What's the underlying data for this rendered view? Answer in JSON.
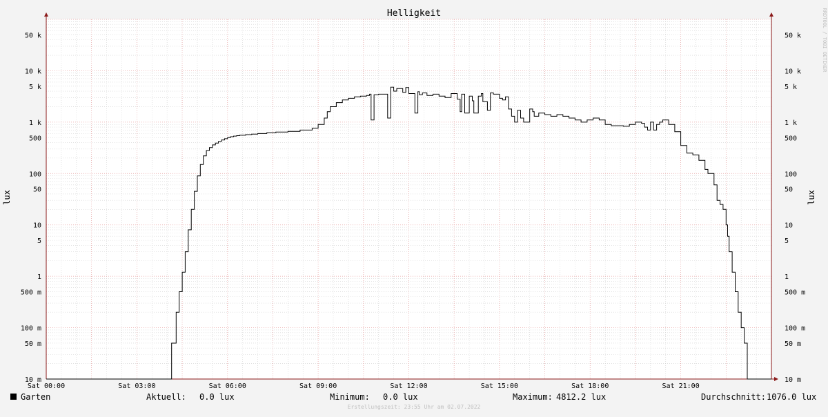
{
  "chart_data": {
    "type": "line",
    "title": "Helligkeit",
    "ylabel": "lux",
    "y_scale": "log",
    "ylim": [
      0.01,
      100000
    ],
    "grid": true,
    "xlim_hours": [
      0,
      24
    ],
    "x_ticks": [
      {
        "h": 0,
        "label": "Sat 00:00"
      },
      {
        "h": 3,
        "label": "Sat 03:00"
      },
      {
        "h": 6,
        "label": "Sat 06:00"
      },
      {
        "h": 9,
        "label": "Sat 09:00"
      },
      {
        "h": 12,
        "label": "Sat 12:00"
      },
      {
        "h": 15,
        "label": "Sat 15:00"
      },
      {
        "h": 18,
        "label": "Sat 18:00"
      },
      {
        "h": 21,
        "label": "Sat 21:00"
      }
    ],
    "y_ticks": [
      {
        "v": 50000,
        "label": "50 k"
      },
      {
        "v": 10000,
        "label": "10 k"
      },
      {
        "v": 5000,
        "label": "5 k"
      },
      {
        "v": 1000,
        "label": "1 k"
      },
      {
        "v": 500,
        "label": "500"
      },
      {
        "v": 100,
        "label": "100"
      },
      {
        "v": 50,
        "label": "50"
      },
      {
        "v": 10,
        "label": "10"
      },
      {
        "v": 5,
        "label": "5"
      },
      {
        "v": 1,
        "label": "1"
      },
      {
        "v": 0.5,
        "label": "500 m"
      },
      {
        "v": 0.1,
        "label": "100 m"
      },
      {
        "v": 0.05,
        "label": "50 m"
      },
      {
        "v": 0.01,
        "label": "10 m"
      }
    ],
    "series": [
      {
        "name": "Garten",
        "color": "#000000",
        "x_hours": [
          0.0,
          4.1,
          4.15,
          4.3,
          4.4,
          4.5,
          4.6,
          4.7,
          4.8,
          4.9,
          5.0,
          5.1,
          5.2,
          5.3,
          5.4,
          5.5,
          5.6,
          5.7,
          5.8,
          5.9,
          6.0,
          6.1,
          6.2,
          6.3,
          6.4,
          6.6,
          6.8,
          7.0,
          7.3,
          7.6,
          8.0,
          8.4,
          8.8,
          9.0,
          9.2,
          9.3,
          9.4,
          9.6,
          9.8,
          10.0,
          10.2,
          10.4,
          10.6,
          10.7,
          10.75,
          10.85,
          11.0,
          11.2,
          11.3,
          11.4,
          11.5,
          11.6,
          11.8,
          11.9,
          12.0,
          12.2,
          12.3,
          12.35,
          12.45,
          12.6,
          12.8,
          13.0,
          13.2,
          13.4,
          13.6,
          13.7,
          13.75,
          13.85,
          14.0,
          14.1,
          14.15,
          14.3,
          14.4,
          14.45,
          14.6,
          14.7,
          14.8,
          15.0,
          15.1,
          15.2,
          15.3,
          15.4,
          15.5,
          15.6,
          15.7,
          15.8,
          16.0,
          16.1,
          16.15,
          16.3,
          16.5,
          16.7,
          16.9,
          17.1,
          17.3,
          17.5,
          17.7,
          17.9,
          18.1,
          18.3,
          18.5,
          18.7,
          18.9,
          19.1,
          19.3,
          19.5,
          19.7,
          19.8,
          19.9,
          20.0,
          20.1,
          20.2,
          20.3,
          20.4,
          20.6,
          20.8,
          21.0,
          21.2,
          21.4,
          21.6,
          21.8,
          21.9,
          22.1,
          22.2,
          22.3,
          22.4,
          22.5,
          22.55,
          22.6,
          22.7,
          22.8,
          22.9,
          23.0,
          23.1,
          23.15,
          23.2,
          23.3,
          24.0
        ],
        "y": [
          0.01,
          0.01,
          0.05,
          0.2,
          0.5,
          1.2,
          3,
          8,
          20,
          45,
          90,
          150,
          220,
          280,
          320,
          360,
          390,
          420,
          450,
          475,
          500,
          520,
          535,
          545,
          555,
          570,
          585,
          600,
          620,
          640,
          660,
          700,
          760,
          900,
          1200,
          1600,
          2000,
          2400,
          2700,
          2900,
          3100,
          3200,
          3300,
          3500,
          1100,
          3400,
          3500,
          3500,
          1200,
          4800,
          4000,
          4500,
          3800,
          4700,
          3600,
          1500,
          3900,
          3400,
          3700,
          3300,
          3500,
          3200,
          3000,
          3600,
          2800,
          1600,
          3500,
          1500,
          3200,
          2600,
          1500,
          3200,
          3600,
          2500,
          1700,
          3700,
          3500,
          2900,
          2700,
          3100,
          1800,
          1300,
          1000,
          1700,
          1200,
          1000,
          1800,
          1600,
          1300,
          1500,
          1400,
          1300,
          1400,
          1300,
          1200,
          1100,
          1000,
          1100,
          1200,
          1100,
          900,
          850,
          850,
          830,
          900,
          1000,
          950,
          800,
          700,
          1000,
          700,
          900,
          1000,
          1100,
          900,
          650,
          350,
          250,
          230,
          180,
          120,
          100,
          60,
          30,
          25,
          20,
          10,
          6,
          3,
          1.2,
          0.5,
          0.2,
          0.1,
          0.05,
          0.05,
          0.01,
          0.01
        ]
      }
    ],
    "legend_label": "Garten",
    "stats": {
      "current_label": "Aktuell:",
      "current_value": "0.0 lux",
      "min_label": "Minimum:",
      "min_value": "0.0 lux",
      "max_label": "Maximum:",
      "max_value": "4812.2 lux",
      "avg_label": "Durchschnitt:",
      "avg_value": "1076.0 lux"
    },
    "footer": "Erstellungszeit: 23:55 Uhr am 02.07.2022",
    "watermark": "RRDTOOL / TOBI OETIKER",
    "colors": {
      "background": "#f3f3f3",
      "plot_bg": "#ffffff",
      "major_grid": "#e8a0a0",
      "minor_grid": "#d0d0d0",
      "axis": "#8b1a1a"
    }
  }
}
